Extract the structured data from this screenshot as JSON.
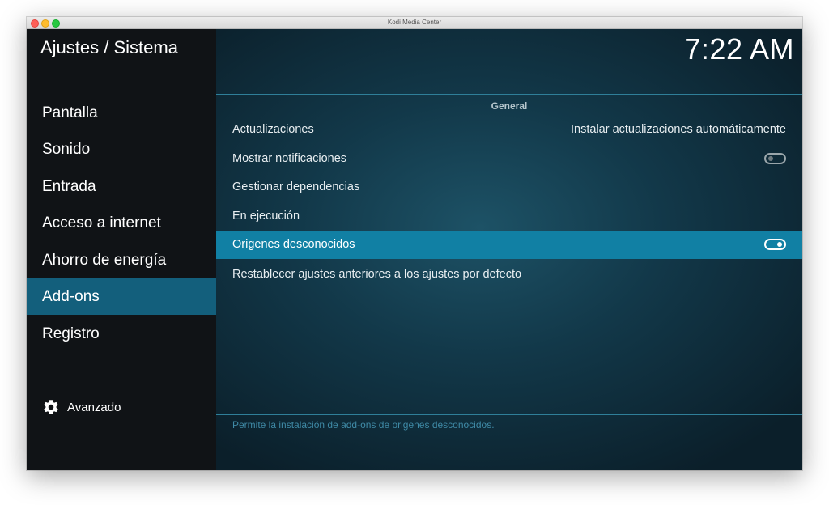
{
  "window": {
    "title": "Kodi Media Center"
  },
  "header": {
    "title": "Ajustes / Sistema",
    "clock": "7:22 AM"
  },
  "sidebar": {
    "items": [
      {
        "label": "Pantalla"
      },
      {
        "label": "Sonido"
      },
      {
        "label": "Entrada"
      },
      {
        "label": "Acceso a internet"
      },
      {
        "label": "Ahorro de energía"
      },
      {
        "label": "Add-ons",
        "active": true
      },
      {
        "label": "Registro"
      }
    ],
    "advanced": {
      "label": "Avanzado",
      "icon": "gear-icon"
    }
  },
  "main": {
    "section": "General",
    "rows": [
      {
        "label": "Actualizaciones",
        "value": "Instalar actualizaciones automáticamente"
      },
      {
        "label": "Mostrar notificaciones",
        "toggle": false
      },
      {
        "label": "Gestionar dependencias"
      },
      {
        "label": "En ejecución"
      },
      {
        "label": "Origenes desconocidos",
        "toggle": true,
        "selected": true
      },
      {
        "label": "Restablecer ajustes anteriores a los ajustes por defecto"
      }
    ],
    "hint": "Permite la instalación de add-ons de origenes desconocidos."
  },
  "colors": {
    "accent": "#1180a4",
    "sidebar_active": "#135f7c",
    "sidebar_bg": "#101316"
  }
}
